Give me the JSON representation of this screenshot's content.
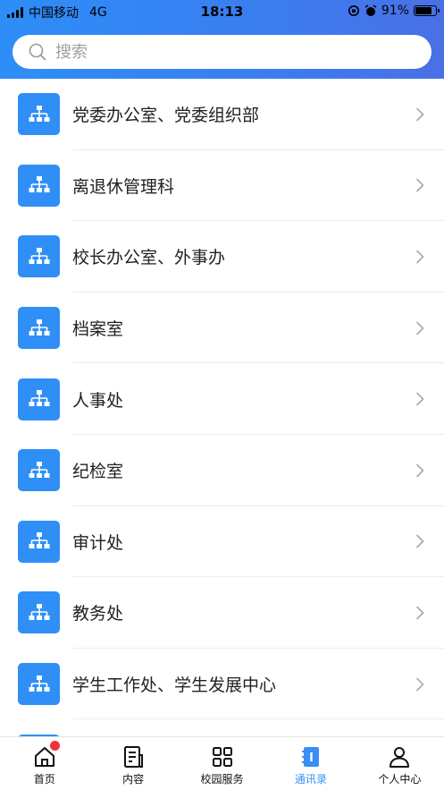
{
  "status_bar": {
    "carrier": "中国移动",
    "network": "4G",
    "time": "18:13",
    "battery_percent": "91%",
    "battery_level": 0.91
  },
  "search": {
    "placeholder": "搜索",
    "icon": "search-icon"
  },
  "departments": [
    {
      "label": "党委办公室、党委组织部",
      "icon": "org-chart-icon"
    },
    {
      "label": "离退休管理科",
      "icon": "org-chart-icon"
    },
    {
      "label": "校长办公室、外事办",
      "icon": "org-chart-icon"
    },
    {
      "label": "档案室",
      "icon": "org-chart-icon"
    },
    {
      "label": "人事处",
      "icon": "org-chart-icon"
    },
    {
      "label": "纪检室",
      "icon": "org-chart-icon"
    },
    {
      "label": "审计处",
      "icon": "org-chart-icon"
    },
    {
      "label": "教务处",
      "icon": "org-chart-icon"
    },
    {
      "label": "学生工作处、学生发展中心",
      "icon": "org-chart-icon"
    },
    {
      "label": "",
      "icon": "org-chart-icon"
    }
  ],
  "tabbar": {
    "items": [
      {
        "label": "首页",
        "icon": "home-icon",
        "badge": true,
        "active": false
      },
      {
        "label": "内容",
        "icon": "document-icon",
        "active": false
      },
      {
        "label": "校园服务",
        "icon": "grid-icon",
        "active": false
      },
      {
        "label": "通讯录",
        "icon": "contacts-book-icon",
        "active": true
      },
      {
        "label": "个人中心",
        "icon": "user-icon",
        "active": false
      }
    ]
  },
  "colors": {
    "accent": "#2f8ff7",
    "header_start": "#2e8ef8",
    "header_end": "#4a70e6",
    "badge": "#f2323a"
  }
}
